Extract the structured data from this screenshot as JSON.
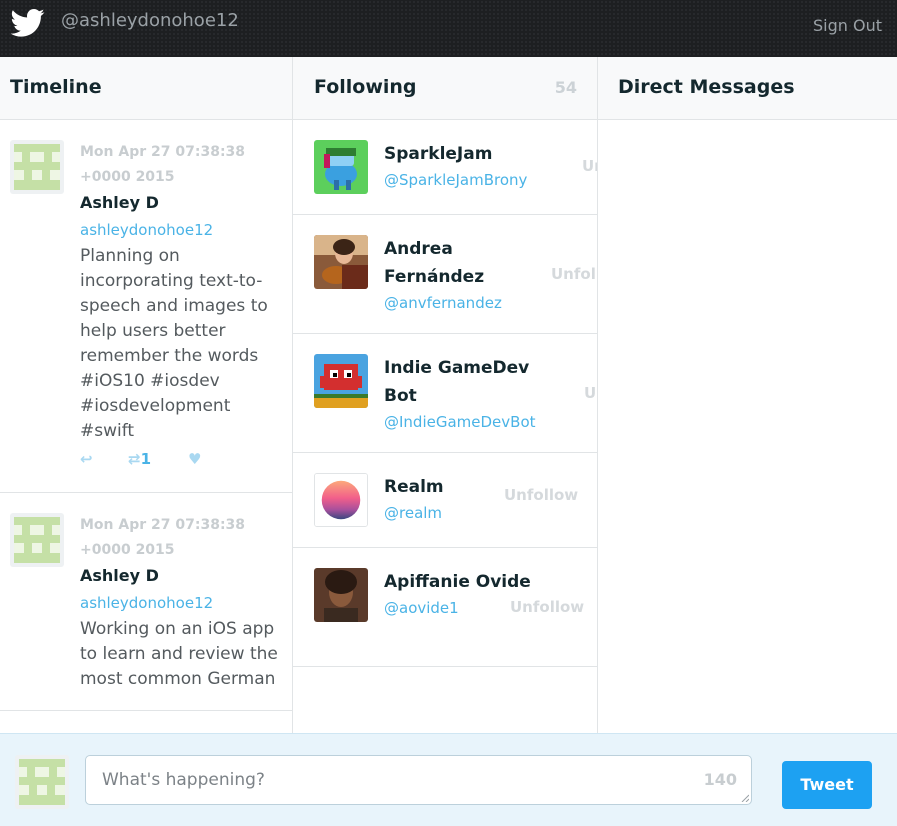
{
  "header": {
    "handle": "@ashleydonohoe12",
    "sign_out": "Sign Out",
    "logo_icon": "twitter-bird-icon"
  },
  "timeline": {
    "title": "Timeline",
    "tweets": [
      {
        "date": "Mon Apr 27 07:38:38 +0000 2015",
        "name": "Ashley D",
        "username": "ashleydonohoe12",
        "text": "Planning on incorporating text-to-speech and images to help users better remember the words #iOS10 #iosdev #iosdevelopment #swift",
        "retweet_count": "1"
      },
      {
        "date": "Mon Apr 27 07:38:38 +0000 2015",
        "name": "Ashley D",
        "username": "ashleydonohoe12",
        "text": "Working on an iOS app to learn and review the most common German"
      }
    ]
  },
  "following": {
    "title": "Following",
    "count": "54",
    "users": [
      {
        "name": "SparkleJam",
        "handle": "@SparkleJamBrony",
        "action": "Unfollow"
      },
      {
        "name": "Andrea Fernández",
        "handle": "@anvfernandez",
        "action": "Unfollow"
      },
      {
        "name": "Indie GameDev Bot",
        "handle": "@IndieGameDevBot",
        "action": "Unfollow"
      },
      {
        "name": "Realm",
        "handle": "@realm",
        "action": "Unfollow"
      },
      {
        "name": "Apiffanie Ovide",
        "handle": "@aovide1",
        "action": "Unfollow"
      }
    ]
  },
  "direct_messages": {
    "title": "Direct Messages"
  },
  "compose": {
    "placeholder": "What's happening?",
    "remaining": "140",
    "button": "Tweet"
  },
  "colors": {
    "accent": "#1da1f2",
    "link": "#4ab3e6",
    "header_bg": "#1d1f21"
  }
}
